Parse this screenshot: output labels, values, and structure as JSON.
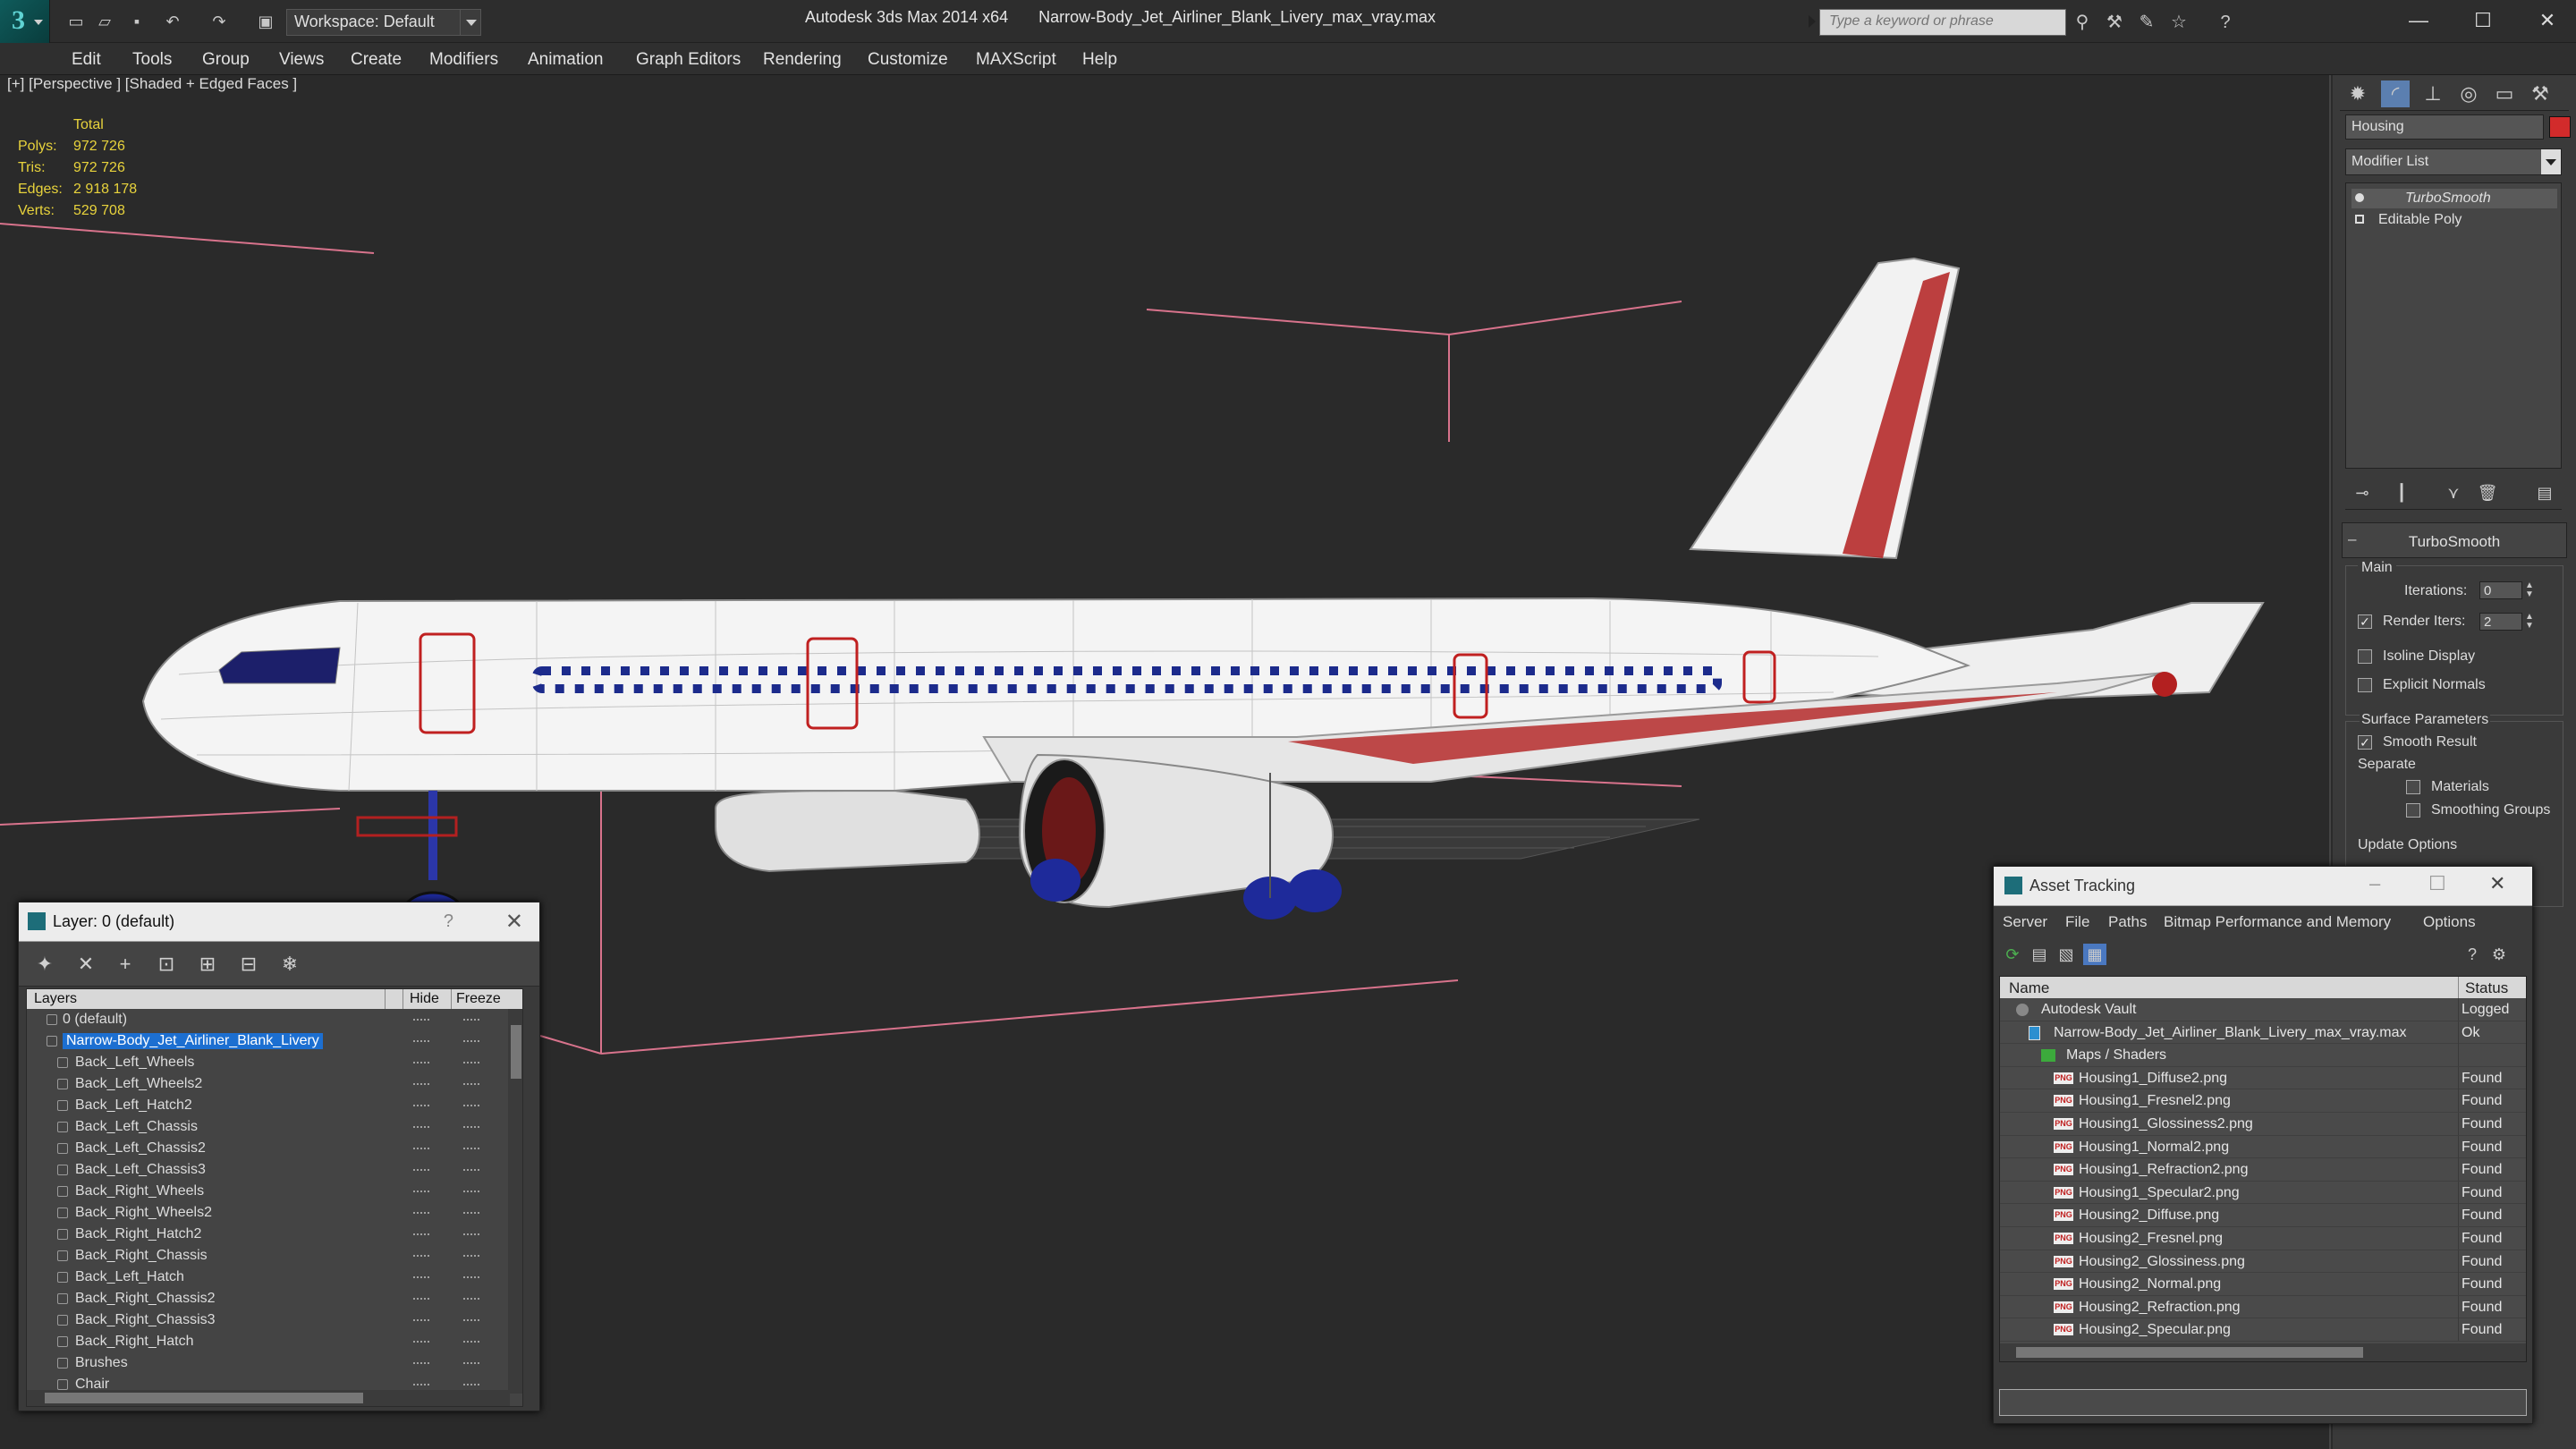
{
  "title_bar": {
    "app_title": "Autodesk 3ds Max  2014 x64",
    "file_title": "Narrow-Body_Jet_Airliner_Blank_Livery_max_vray.max",
    "workspace": "Workspace: Default",
    "search_placeholder": "Type a keyword or phrase",
    "minimize": "—",
    "maximize": "☐",
    "close": "✕"
  },
  "menu": [
    "Edit",
    "Tools",
    "Group",
    "Views",
    "Create",
    "Modifiers",
    "Animation",
    "Graph Editors",
    "Rendering",
    "Customize",
    "MAXScript",
    "Help"
  ],
  "viewport": {
    "label": "[+] [Perspective ] [Shaded + Edged Faces ]",
    "stats_header": "Total",
    "stats": [
      {
        "label": "Polys:",
        "value": "972 726"
      },
      {
        "label": "Tris:",
        "value": "972 726"
      },
      {
        "label": "Edges:",
        "value": "2 918 178"
      },
      {
        "label": "Verts:",
        "value": "529 708"
      }
    ]
  },
  "layer_dialog": {
    "title": "Layer: 0 (default)",
    "help": "?",
    "close": "✕",
    "columns": {
      "layers": "Layers",
      "hide": "Hide",
      "freeze": "Freeze"
    },
    "rows": [
      {
        "name": "0 (default)",
        "level": 1,
        "selected": false
      },
      {
        "name": "Narrow-Body_Jet_Airliner_Blank_Livery",
        "level": 1,
        "selected": true
      },
      {
        "name": "Back_Left_Wheels",
        "level": 2,
        "selected": false
      },
      {
        "name": "Back_Left_Wheels2",
        "level": 2,
        "selected": false
      },
      {
        "name": "Back_Left_Hatch2",
        "level": 2,
        "selected": false
      },
      {
        "name": "Back_Left_Chassis",
        "level": 2,
        "selected": false
      },
      {
        "name": "Back_Left_Chassis2",
        "level": 2,
        "selected": false
      },
      {
        "name": "Back_Left_Chassis3",
        "level": 2,
        "selected": false
      },
      {
        "name": "Back_Right_Wheels",
        "level": 2,
        "selected": false
      },
      {
        "name": "Back_Right_Wheels2",
        "level": 2,
        "selected": false
      },
      {
        "name": "Back_Right_Hatch2",
        "level": 2,
        "selected": false
      },
      {
        "name": "Back_Right_Chassis",
        "level": 2,
        "selected": false
      },
      {
        "name": "Back_Left_Hatch",
        "level": 2,
        "selected": false
      },
      {
        "name": "Back_Right_Chassis2",
        "level": 2,
        "selected": false
      },
      {
        "name": "Back_Right_Chassis3",
        "level": 2,
        "selected": false
      },
      {
        "name": "Back_Right_Hatch",
        "level": 2,
        "selected": false
      },
      {
        "name": "Brushes",
        "level": 2,
        "selected": false
      },
      {
        "name": "Chair",
        "level": 2,
        "selected": false
      }
    ]
  },
  "command_panel": {
    "object_name": "Housing",
    "object_color": "#d22b2b",
    "modifier_list": "Modifier List",
    "stack": [
      "TurboSmooth",
      "Editable Poly"
    ],
    "rollout_title": "TurboSmooth",
    "main_label": "Main",
    "iterations_label": "Iterations:",
    "iterations_value": "0",
    "render_iters_label": "Render Iters:",
    "render_iters_value": "2",
    "isoline_label": "Isoline Display",
    "explicit_normals_label": "Explicit Normals",
    "surface_params_label": "Surface Parameters",
    "smooth_result_label": "Smooth Result",
    "separate_label": "Separate",
    "materials_label": "Materials",
    "smoothing_groups_label": "Smoothing Groups",
    "update_options_label": "Update Options"
  },
  "asset_dialog": {
    "title": "Asset Tracking",
    "menu": [
      "Server",
      "File",
      "Paths",
      "Bitmap Performance and Memory",
      "Options"
    ],
    "columns": {
      "name": "Name",
      "status": "Status"
    },
    "rows": [
      {
        "name": "Autodesk Vault",
        "status": "Logged",
        "kind": "vault",
        "indent": 1
      },
      {
        "name": "Narrow-Body_Jet_Airliner_Blank_Livery_max_vray.max",
        "status": "Ok",
        "kind": "file",
        "indent": 2
      },
      {
        "name": "Maps / Shaders",
        "status": "",
        "kind": "folder",
        "indent": 3
      },
      {
        "name": "Housing1_Diffuse2.png",
        "status": "Found",
        "kind": "png",
        "indent": 4
      },
      {
        "name": "Housing1_Fresnel2.png",
        "status": "Found",
        "kind": "png",
        "indent": 4
      },
      {
        "name": "Housing1_Glossiness2.png",
        "status": "Found",
        "kind": "png",
        "indent": 4
      },
      {
        "name": "Housing1_Normal2.png",
        "status": "Found",
        "kind": "png",
        "indent": 4
      },
      {
        "name": "Housing1_Refraction2.png",
        "status": "Found",
        "kind": "png",
        "indent": 4
      },
      {
        "name": "Housing1_Specular2.png",
        "status": "Found",
        "kind": "png",
        "indent": 4
      },
      {
        "name": "Housing2_Diffuse.png",
        "status": "Found",
        "kind": "png",
        "indent": 4
      },
      {
        "name": "Housing2_Fresnel.png",
        "status": "Found",
        "kind": "png",
        "indent": 4
      },
      {
        "name": "Housing2_Glossiness.png",
        "status": "Found",
        "kind": "png",
        "indent": 4
      },
      {
        "name": "Housing2_Normal.png",
        "status": "Found",
        "kind": "png",
        "indent": 4
      },
      {
        "name": "Housing2_Refraction.png",
        "status": "Found",
        "kind": "png",
        "indent": 4
      },
      {
        "name": "Housing2_Specular.png",
        "status": "Found",
        "kind": "png",
        "indent": 4
      }
    ]
  }
}
